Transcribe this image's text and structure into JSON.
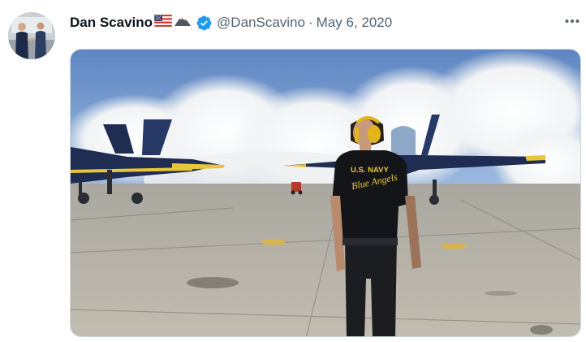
{
  "tweet": {
    "display_name": "Dan Scavino",
    "name_emojis": [
      "us-flag-icon",
      "mountain-icon"
    ],
    "verified": true,
    "handle": "@DanScavino",
    "separator": "·",
    "date": "May 6, 2020",
    "more_icon": "more-icon"
  },
  "media": {
    "type": "video-still",
    "shirt_text_line1": "U.S. NAVY",
    "shirt_text_line2": "Blue Angels"
  },
  "colors": {
    "name": "#0f1419",
    "secondary_text": "#536471",
    "verified_blue": "#1d9bf0",
    "jet_blue": "#1f2d52",
    "jet_yellow": "#e8c53b",
    "tarmac": "#b6b2a8",
    "sky": "#7fa9d6"
  }
}
